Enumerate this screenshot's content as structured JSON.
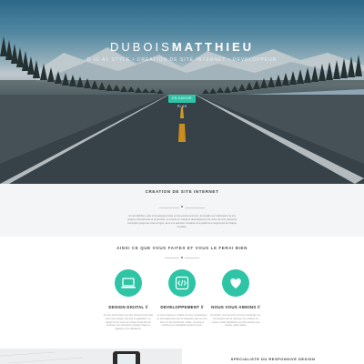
{
  "hero": {
    "title_part1": "DUBOIS",
    "title_part2": "MATTHIEU",
    "subtitle": "D  IG   AL STYLE  •  CREATION DE SITE INTERNET  •  DEVELOPPEUR",
    "button_label": "EN SAVOIR PLUS"
  },
  "creation": {
    "title": "CREATION DE SITE INTERNET",
    "paragraph": "Je suis Matthieu, web et developpeur base sur les environnements. Je travaille sur l'elaboration de vos projets professionnels et personnels. Je prends en charge le developpement de votre site web, depuis la conception jusqu'a la mise en ligne, avec une attention constante a la qualite et a l'ergonomie de chaque interface."
  },
  "services": {
    "heading": "AINSI CE QUE VOUS FAITES ET VOUS LE FERAI BIEN",
    "items": [
      {
        "name": "DESIGN DIGITAL //",
        "icon": "laptop-icon",
        "description": "Je vous fournit aussi une liste d'elements de base pour votre design, site web et application. Le design est au coeur de chaque projet afin de proposer une experience visuelle unique et adaptee a vos utilisateurs."
      },
      {
        "name": "DEVELOPPEMENT //",
        "icon": "code-icon",
        "description": "Je vous propose le meilleur de mes competences en developpement web et integration afin de vous livrer un site fonctionnel, rapide, securise et conforme aux standards actuels du web."
      },
      {
        "name": "NOUS VOUS AIMONS //",
        "icon": "heart-icon",
        "description": "Ensemble, nous prenons le temps d'echanger sur vos besoins afin de proposer une solution sur mesure. Votre satisfaction est notre priorite pour chaque projet realise."
      }
    ]
  },
  "bottom": {
    "title": "SPECIALISTE DU RESPONSIVE DESIGN"
  },
  "colors": {
    "accent": "#2ec4a6",
    "section_bg": "#f4f5f7"
  }
}
